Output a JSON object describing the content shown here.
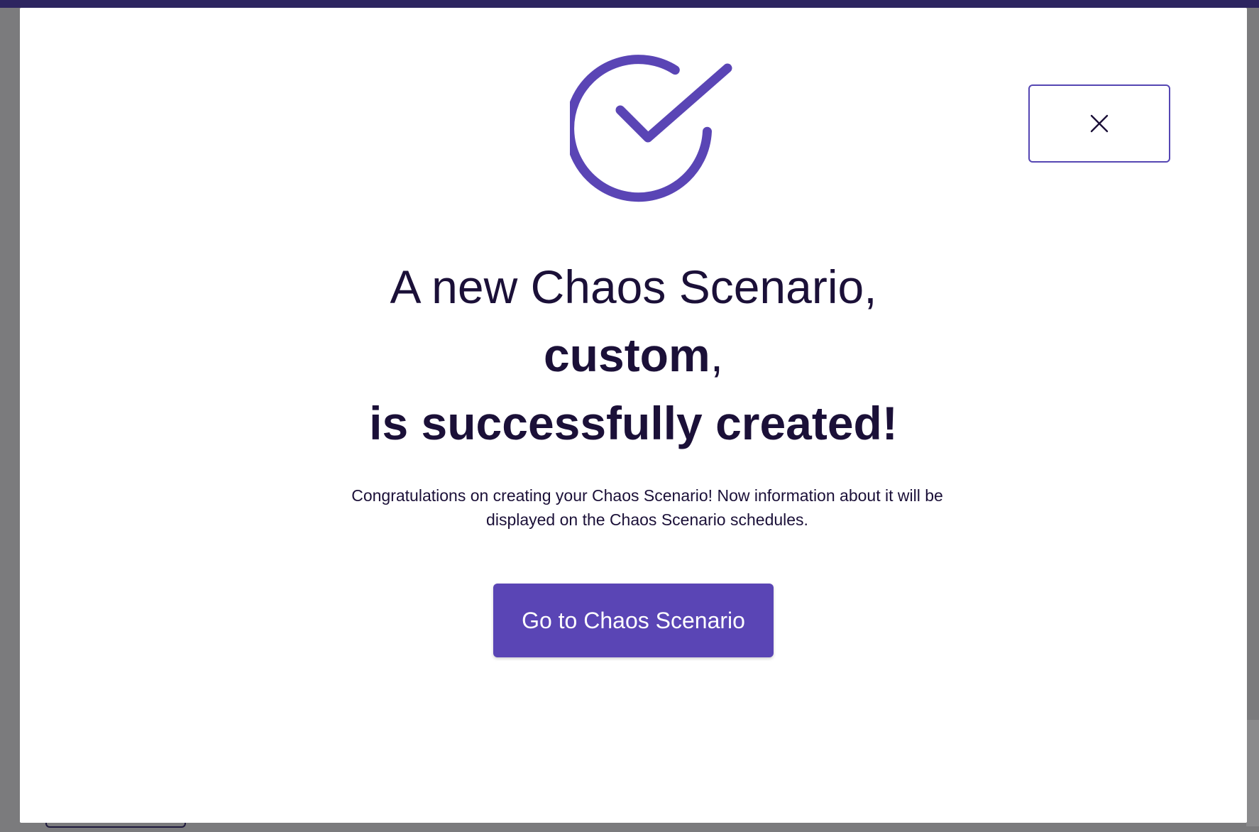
{
  "colors": {
    "accent": "#5a45b5",
    "text_dark": "#1b1038",
    "overlay": "#7b7b7d",
    "topbar": "#2d2560"
  },
  "modal": {
    "icon": "check-circle-icon",
    "close_icon": "close-icon",
    "headline": {
      "line1": "A new Chaos Scenario,",
      "scenario_name": "custom",
      "comma": ",",
      "line3": "is successfully created!"
    },
    "description": "Congratulations on creating your Chaos Scenario! Now information about it will be displayed on the Chaos Scenario schedules.",
    "primary_button_label": "Go to Chaos Scenario"
  }
}
